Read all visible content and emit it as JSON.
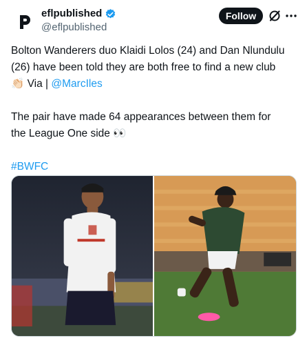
{
  "author": {
    "display_name": "eflpublished",
    "handle": "@eflpublished",
    "verified": true,
    "avatar_icon": "p-logo-icon"
  },
  "actions": {
    "follow_label": "Follow",
    "grok_icon": "grok-icon",
    "more_icon": "more-icon"
  },
  "tweet": {
    "line1": "Bolton Wanderers duo Klaidi Lolos (24) and Dan Nlundulu",
    "line2": "(26) have been told they are both free to find a new club",
    "clap_emoji": "👏🏻",
    "via_text": " Via | ",
    "mention": "@MarcIles",
    "line4": "The pair have made 64 appearances between them for",
    "line5": "the League One side",
    "eyes_emoji": "👀",
    "hashtag": "#BWFC"
  },
  "colors": {
    "link": "#1d9bf0",
    "text": "#0f1419",
    "secondary": "#536471",
    "verified": "#1d9bf0"
  }
}
